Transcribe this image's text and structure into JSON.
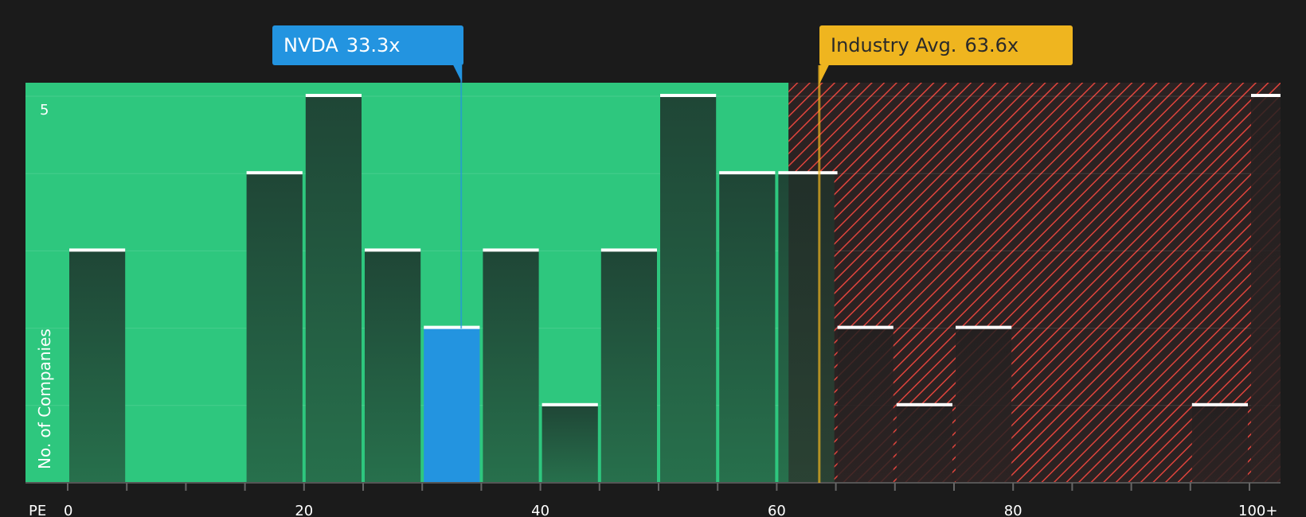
{
  "callouts": {
    "company": {
      "label": "NVDA",
      "value": "33.3x",
      "pe": 33.3,
      "color": "#2394e0"
    },
    "industry": {
      "label": "Industry Avg.",
      "value": "63.6x",
      "pe": 63.6,
      "color": "#efb51f"
    }
  },
  "colors": {
    "background": "#1b1b1b",
    "undervalued_zone": "#2ec77e",
    "overvalued_zone": "#2b2222",
    "overvalued_hatch": "#e0443c",
    "bar": "#1f4a36",
    "highlight_bar": "#2394e0",
    "bar_cap": "#ffffff"
  },
  "chart_data": {
    "type": "bar",
    "xlabel": "PE",
    "ylabel": "No. of Companies",
    "x_ticks": [
      "0",
      "20",
      "40",
      "60",
      "80",
      "100+"
    ],
    "y_ticks": [
      "5"
    ],
    "ylim": [
      0,
      5.17
    ],
    "bin_width": 5,
    "bins": [
      {
        "x0": 0,
        "x1": 5,
        "count": 3
      },
      {
        "x0": 5,
        "x1": 10,
        "count": 0
      },
      {
        "x0": 10,
        "x1": 15,
        "count": 0
      },
      {
        "x0": 15,
        "x1": 20,
        "count": 4
      },
      {
        "x0": 20,
        "x1": 25,
        "count": 5
      },
      {
        "x0": 25,
        "x1": 30,
        "count": 3
      },
      {
        "x0": 30,
        "x1": 35,
        "count": 2,
        "highlight": true
      },
      {
        "x0": 35,
        "x1": 40,
        "count": 3
      },
      {
        "x0": 40,
        "x1": 45,
        "count": 1
      },
      {
        "x0": 45,
        "x1": 50,
        "count": 3
      },
      {
        "x0": 50,
        "x1": 55,
        "count": 5
      },
      {
        "x0": 55,
        "x1": 60,
        "count": 4
      },
      {
        "x0": 60,
        "x1": 65,
        "count": 4
      },
      {
        "x0": 65,
        "x1": 70,
        "count": 2
      },
      {
        "x0": 70,
        "x1": 75,
        "count": 1
      },
      {
        "x0": 75,
        "x1": 80,
        "count": 2
      },
      {
        "x0": 80,
        "x1": 85,
        "count": 0
      },
      {
        "x0": 85,
        "x1": 90,
        "count": 0
      },
      {
        "x0": 90,
        "x1": 95,
        "count": 0
      },
      {
        "x0": 95,
        "x1": 100,
        "count": 1
      },
      {
        "x0": 100,
        "x1": 105,
        "count": 5,
        "overflow": true
      }
    ],
    "undervalued_until": 61,
    "company_pe": 33.3,
    "industry_avg_pe": 63.6
  }
}
